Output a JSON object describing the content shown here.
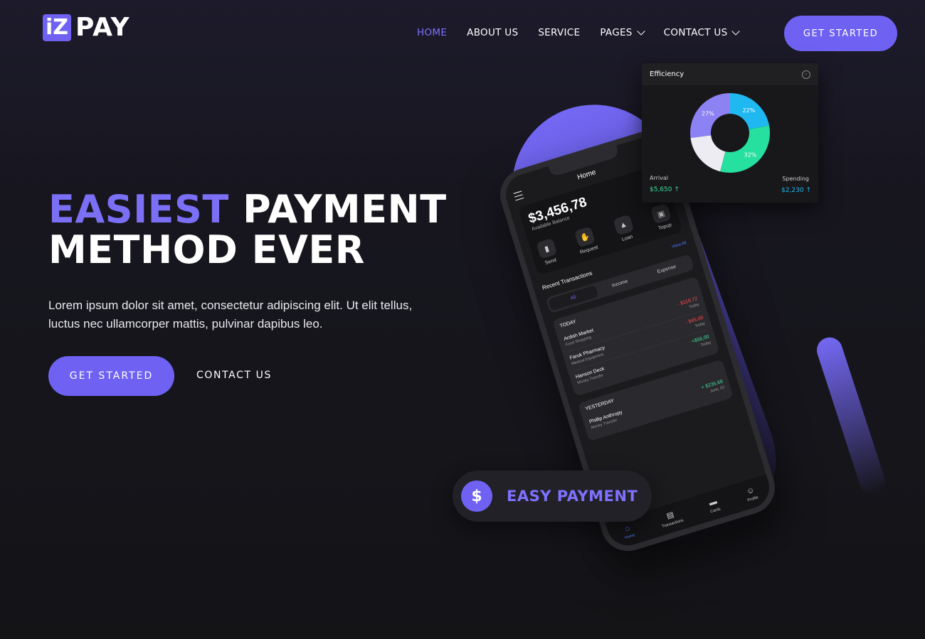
{
  "logo": {
    "mark": "iZ",
    "text": "PAY"
  },
  "nav": [
    {
      "label": "HOME"
    },
    {
      "label": "ABOUT US"
    },
    {
      "label": "SERVICE"
    },
    {
      "label": "PAGES"
    },
    {
      "label": "CONTACT US"
    }
  ],
  "header": {
    "cta_label": "GET STARTED"
  },
  "hero": {
    "title_accent": "EASIEST",
    "title_rest": " PAYMENT",
    "title_line2": "METHOD EVER",
    "description": "Lorem ipsum dolor sit amet, consectetur adipiscing elit. Ut elit tellus, luctus nec ullamcorper mattis, pulvinar dapibus leo.",
    "cta_label": "GET STARTED",
    "contact_label": "CONTACT US"
  },
  "badge": {
    "icon": "$",
    "text": "EASY PAYMENT"
  },
  "efficiency": {
    "title": "Efficiency",
    "arrival_label": "Arrival",
    "arrival_value": "$5,650 ↑",
    "spending_label": "Spending",
    "spending_value": "$2,230 ↑",
    "segments": [
      {
        "label": "22%",
        "value": 22,
        "color": "#1fb8f0"
      },
      {
        "label": "32%",
        "value": 32,
        "color": "#26e0a0"
      },
      {
        "label": "",
        "value": 19,
        "color": "#ececf2"
      },
      {
        "label": "27%",
        "value": 27,
        "color": "#8c82f4"
      }
    ]
  },
  "phone": {
    "title": "Home",
    "balance": "$3,456,78",
    "balance_label": "Available Balance",
    "actions": [
      {
        "label": "Send",
        "icon": "send-icon"
      },
      {
        "label": "Request",
        "icon": "hand-icon"
      },
      {
        "label": "Loan",
        "icon": "bag-icon"
      },
      {
        "label": "Topup",
        "icon": "wallet-icon"
      }
    ],
    "recent_label": "Recent Transactions",
    "view_all": "View All",
    "tabs": [
      "All",
      "Income",
      "Expense"
    ],
    "today_label": "TODAY",
    "today": [
      {
        "name": "Ardish Market",
        "cat": "Food Shopping",
        "amount": "- $118,72",
        "when": "Today",
        "kind": "neg"
      },
      {
        "name": "Faruk Pharmacy",
        "cat": "Medical Equipment",
        "amount": "- $45,00",
        "when": "Today",
        "kind": "neg"
      },
      {
        "name": "Hanson Deck",
        "cat": "Money Transfer",
        "amount": "+$56,00",
        "when": "Today",
        "kind": "pos"
      }
    ],
    "yesterday_label": "YESTERDAY",
    "yesterday": [
      {
        "name": "Phillip Anthropy",
        "cat": "Money Transfer",
        "amount": "+ $235,68",
        "when": "June, 02",
        "kind": "pos"
      }
    ],
    "bottom_nav": [
      {
        "label": "Home",
        "icon": "home-icon"
      },
      {
        "label": "Transactions",
        "icon": "receipt-icon"
      },
      {
        "label": "Cards",
        "icon": "card-icon"
      },
      {
        "label": "Profile",
        "icon": "user-icon"
      }
    ]
  },
  "colors": {
    "accent": "#6f62f2",
    "accent_text": "#7b6ff6",
    "bg": "#141417"
  }
}
